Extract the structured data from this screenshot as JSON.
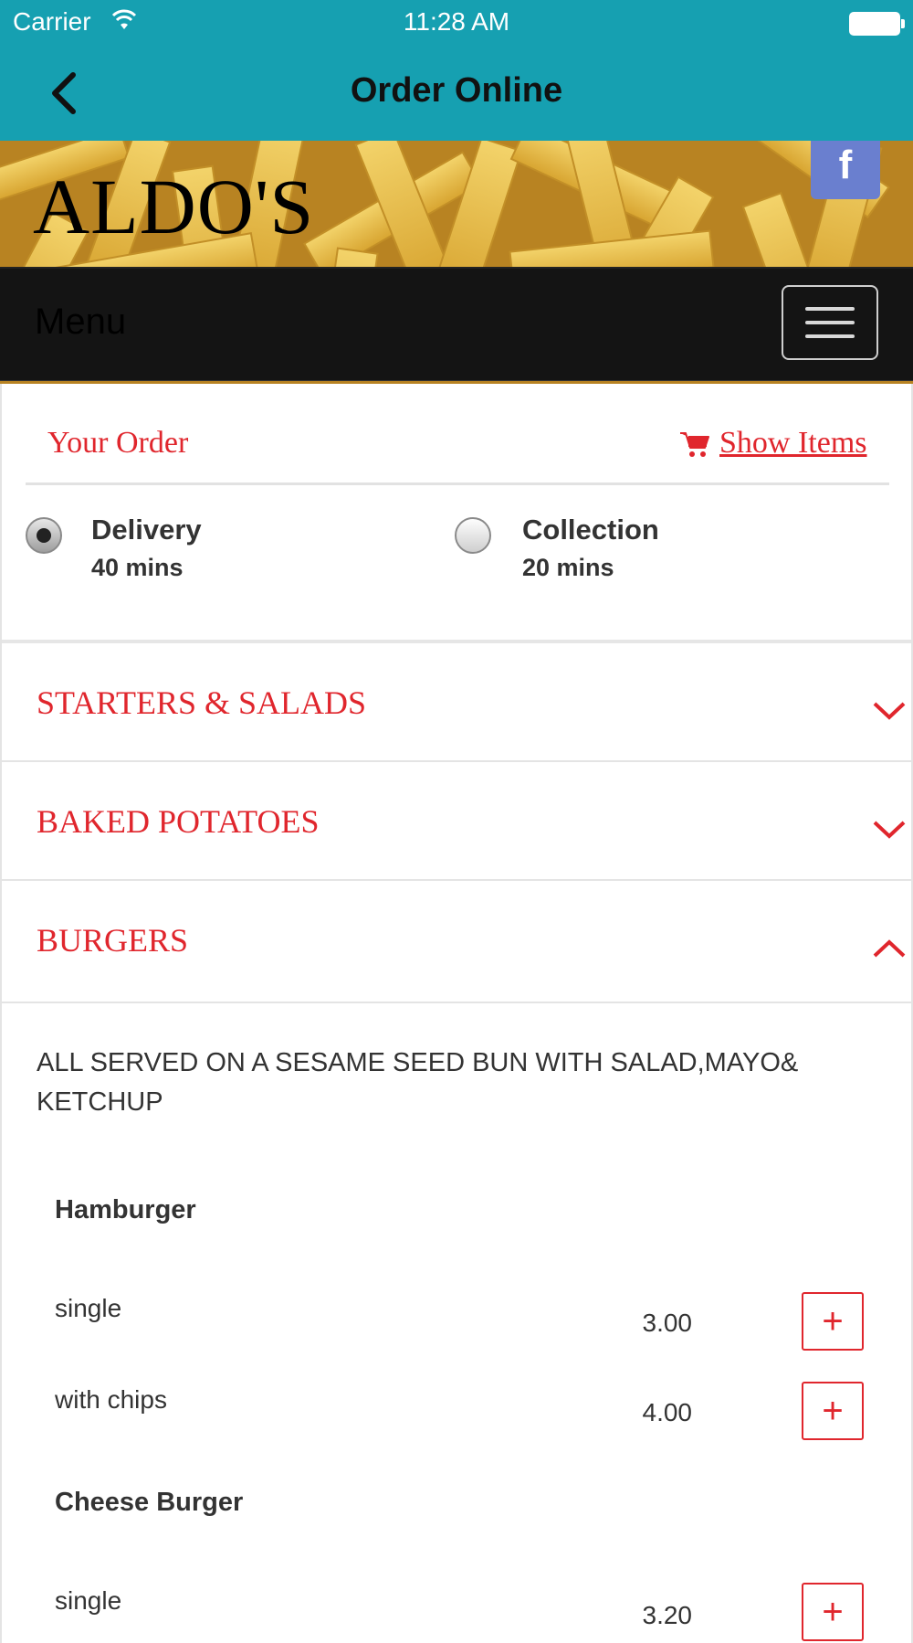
{
  "status_bar": {
    "carrier": "Carrier",
    "time": "11:28 AM"
  },
  "nav": {
    "title": "Order Online"
  },
  "header": {
    "brand": "ALDO'S",
    "facebook_glyph": "f",
    "menu_label": "Menu"
  },
  "order": {
    "your_order": "Your Order",
    "show_items": "Show Items",
    "options": [
      {
        "label": "Delivery",
        "time": "40 mins",
        "selected": true
      },
      {
        "label": "Collection",
        "time": "20 mins",
        "selected": false
      }
    ]
  },
  "categories": [
    {
      "name": "STARTERS & SALADS",
      "expanded": false
    },
    {
      "name": "BAKED POTATOES",
      "expanded": false
    },
    {
      "name": "BURGERS",
      "expanded": true
    }
  ],
  "burgers": {
    "description": "ALL SERVED ON A SESAME SEED BUN WITH SALAD,MAYO& KETCHUP",
    "items": [
      {
        "name": "Hamburger",
        "options": [
          {
            "label": "single",
            "price": "3.00"
          },
          {
            "label": "with chips",
            "price": "4.00"
          }
        ]
      },
      {
        "name": "Cheese Burger",
        "options": [
          {
            "label": "single",
            "price": "3.20"
          }
        ]
      }
    ],
    "add_label": "+"
  },
  "colors": {
    "nav_bg": "#16a0b1",
    "accent_red": "#e0262d",
    "menubar_bg": "#141414",
    "facebook_bg": "#6a7fcf"
  }
}
